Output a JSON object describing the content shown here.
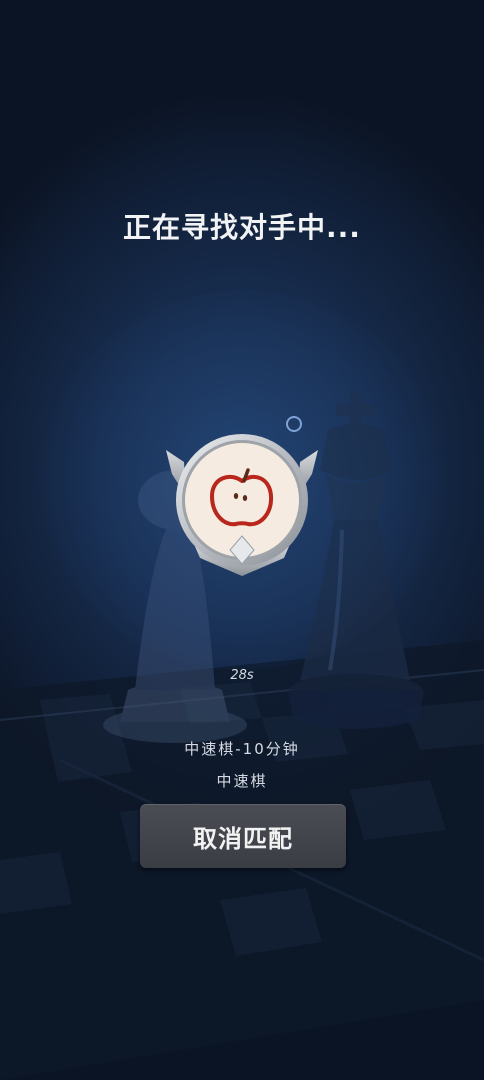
{
  "matchmaking": {
    "title": "正在寻找对手中...",
    "timer": "28s",
    "mode_detail": "中速棋-10分钟",
    "mode_name": "中速棋",
    "cancel_label": "取消匹配"
  },
  "avatar": {
    "icon": "apple-icon"
  },
  "colors": {
    "background": "#0f1a2e",
    "button": "#404349",
    "apple_red": "#b8261c"
  }
}
